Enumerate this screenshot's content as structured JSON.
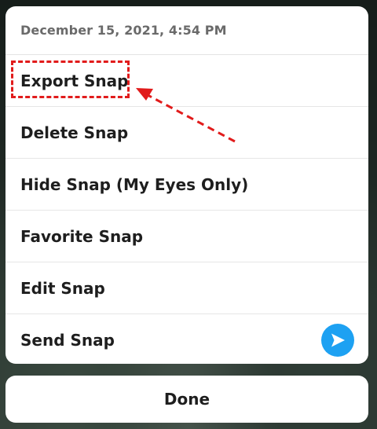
{
  "header": {
    "timestamp": "December 15, 2021, 4:54 PM"
  },
  "menu": {
    "items": [
      {
        "label": "Export Snap"
      },
      {
        "label": "Delete Snap"
      },
      {
        "label": "Hide Snap (My Eyes Only)"
      },
      {
        "label": "Favorite Snap"
      },
      {
        "label": "Edit Snap"
      },
      {
        "label": "Send Snap",
        "icon": "send-arrow-icon"
      }
    ]
  },
  "footer": {
    "done_label": "Done"
  },
  "annotation": {
    "highlighted_item": "Export Snap",
    "color": "#e11b1b"
  },
  "colors": {
    "send_badge": "#1da1f2"
  }
}
